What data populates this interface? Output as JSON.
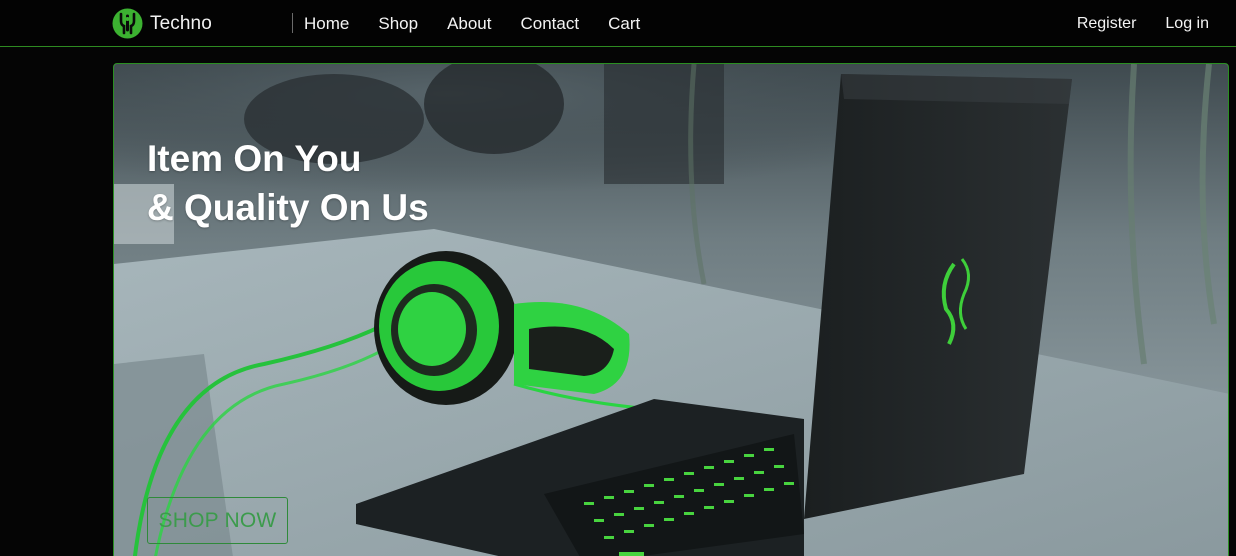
{
  "brand": {
    "name": "Techno",
    "logo_icon": "razer-snake-logo-icon",
    "accent_color": "#3cb231"
  },
  "nav": {
    "links": [
      {
        "label": "Home"
      },
      {
        "label": "Shop"
      },
      {
        "label": "About"
      },
      {
        "label": "Contact"
      },
      {
        "label": "Cart"
      }
    ]
  },
  "auth": {
    "register": "Register",
    "login": "Log in"
  },
  "hero": {
    "title_line1": "Item On You",
    "title_line2": "& Quality On Us",
    "cta_label": "SHOP NOW",
    "image_description_icon": "laptop-headphones-photo",
    "accent_color": "#29b427"
  },
  "colors": {
    "background": "#050505",
    "border": "#2e8a21"
  }
}
